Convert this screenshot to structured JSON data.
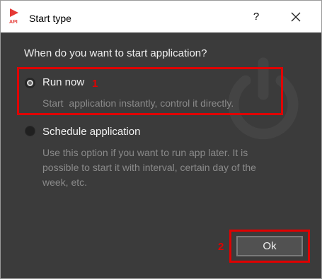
{
  "window": {
    "title": "Start type",
    "help_glyph": "?",
    "close_icon": "close-icon",
    "app_icon": "api-app-icon"
  },
  "dialog": {
    "question": "When do you want to start application?",
    "options": [
      {
        "label": "Run now",
        "description": "Start  application instantly, control it directly.",
        "selected": true
      },
      {
        "label": "Schedule application",
        "description_lines": [
          "Use this option if you want to run app later. It is",
          "possible to start it with interval, certain day of the",
          "week, etc."
        ],
        "selected": false
      }
    ],
    "ok_label": "Ok",
    "watermark_icon": "power-icon"
  },
  "annotations": {
    "marker_1": "1",
    "marker_2": "2",
    "color": "#e00000"
  },
  "colors": {
    "background": "#3b3b3b",
    "text": "#f2f2f2",
    "muted": "#8a8a8a"
  }
}
